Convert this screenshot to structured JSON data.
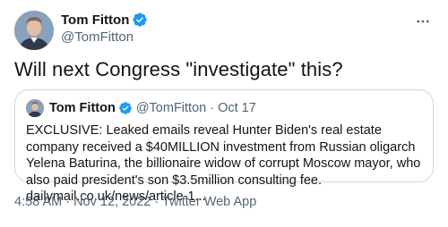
{
  "author": {
    "name": "Tom Fitton",
    "handle": "@TomFitton"
  },
  "tweet": {
    "text": "Will next Congress \"investigate\" this?",
    "footer": "4:58 AM · Nov 12, 2022 · Twitter Web App"
  },
  "quote": {
    "name": "Tom Fitton",
    "handle": "@TomFitton",
    "separator": "·",
    "date": "Oct 17",
    "text": "EXCLUSIVE: Leaked emails reveal Hunter Biden's real estate company received a $40MILLION investment from Russian oligarch Yelena Baturina, the billionaire widow of corrupt Moscow mayor, who also paid president's son $3.5million consulting fee. dailymail.co.uk/news/article-1..."
  },
  "colors": {
    "verified": "#1d9bf0",
    "secondary_text": "#536471",
    "border": "#cfd9de"
  },
  "icons": {
    "verified": "verified-badge-icon",
    "more": "more-dots-icon"
  }
}
